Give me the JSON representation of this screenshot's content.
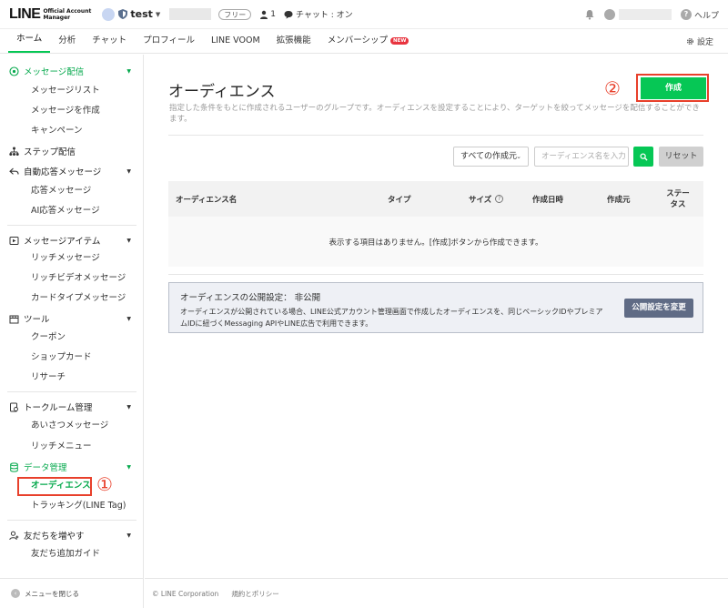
{
  "topbar": {
    "logo_text": "LINE",
    "logo_sub_1": "Official Account",
    "logo_sub_2": "Manager",
    "account_name": "test",
    "plan": "フリー",
    "friends_count": "1",
    "chat_status": "チャット : オン",
    "help": "ヘルプ"
  },
  "nav": {
    "tabs": [
      "ホーム",
      "分析",
      "チャット",
      "プロフィール",
      "LINE VOOM",
      "拡張機能",
      "メンバーシップ"
    ],
    "new_badge": "NEW",
    "settings": "設定"
  },
  "sidebar": {
    "message": {
      "title": "メッセージ配信",
      "items": [
        "メッセージリスト",
        "メッセージを作成",
        "キャンペーン"
      ]
    },
    "step": "ステップ配信",
    "auto_reply": {
      "title": "自動応答メッセージ",
      "items": [
        "応答メッセージ",
        "AI応答メッセージ"
      ]
    },
    "message_items": {
      "title": "メッセージアイテム",
      "items": [
        "リッチメッセージ",
        "リッチビデオメッセージ",
        "カードタイプメッセージ"
      ]
    },
    "tools": {
      "title": "ツール",
      "items": [
        "クーポン",
        "ショップカード",
        "リサーチ"
      ]
    },
    "talkroom": {
      "title": "トークルーム管理",
      "items": [
        "あいさつメッセージ",
        "リッチメニュー"
      ]
    },
    "data": {
      "title": "データ管理",
      "items": [
        "オーディエンス",
        "トラッキング(LINE Tag)"
      ]
    },
    "friends": {
      "title": "友だちを増やす",
      "items": [
        "友だち追加ガイド"
      ]
    },
    "close_menu": "メニューを閉じる"
  },
  "annotations": {
    "one": "①",
    "two": "②"
  },
  "main": {
    "title": "オーディエンス",
    "description": "指定した条件をもとに作成されるユーザーのグループです。オーディエンスを設定することにより、ターゲットを絞ってメッセージを配信することができます。",
    "create_button": "作成",
    "filter_select": "すべての作成元",
    "search_placeholder": "オーディエンス名を入力",
    "reset_button": "リセット",
    "table": {
      "headers": [
        "オーディエンス名",
        "タイプ",
        "サイズ",
        "作成日時",
        "作成元",
        "ステータス"
      ],
      "info_icon": "?",
      "empty_message": "表示する項目はありません。[作成]ボタンから作成できます。"
    },
    "public_setting": {
      "title": "オーディエンスの公開設定： 非公開",
      "description": "オーディエンスが公開されている場合、LINE公式アカウント管理画面で作成したオーディエンスを、同じベーシックIDやプレミアムIDに紐づくMessaging APIやLINE広告で利用できます。",
      "button": "公開設定を変更"
    },
    "footer": {
      "copyright": "© LINE Corporation",
      "terms": "規約とポリシー"
    }
  },
  "colors": {
    "brand_green": "#06c755",
    "annotation_red": "#e8402b"
  }
}
